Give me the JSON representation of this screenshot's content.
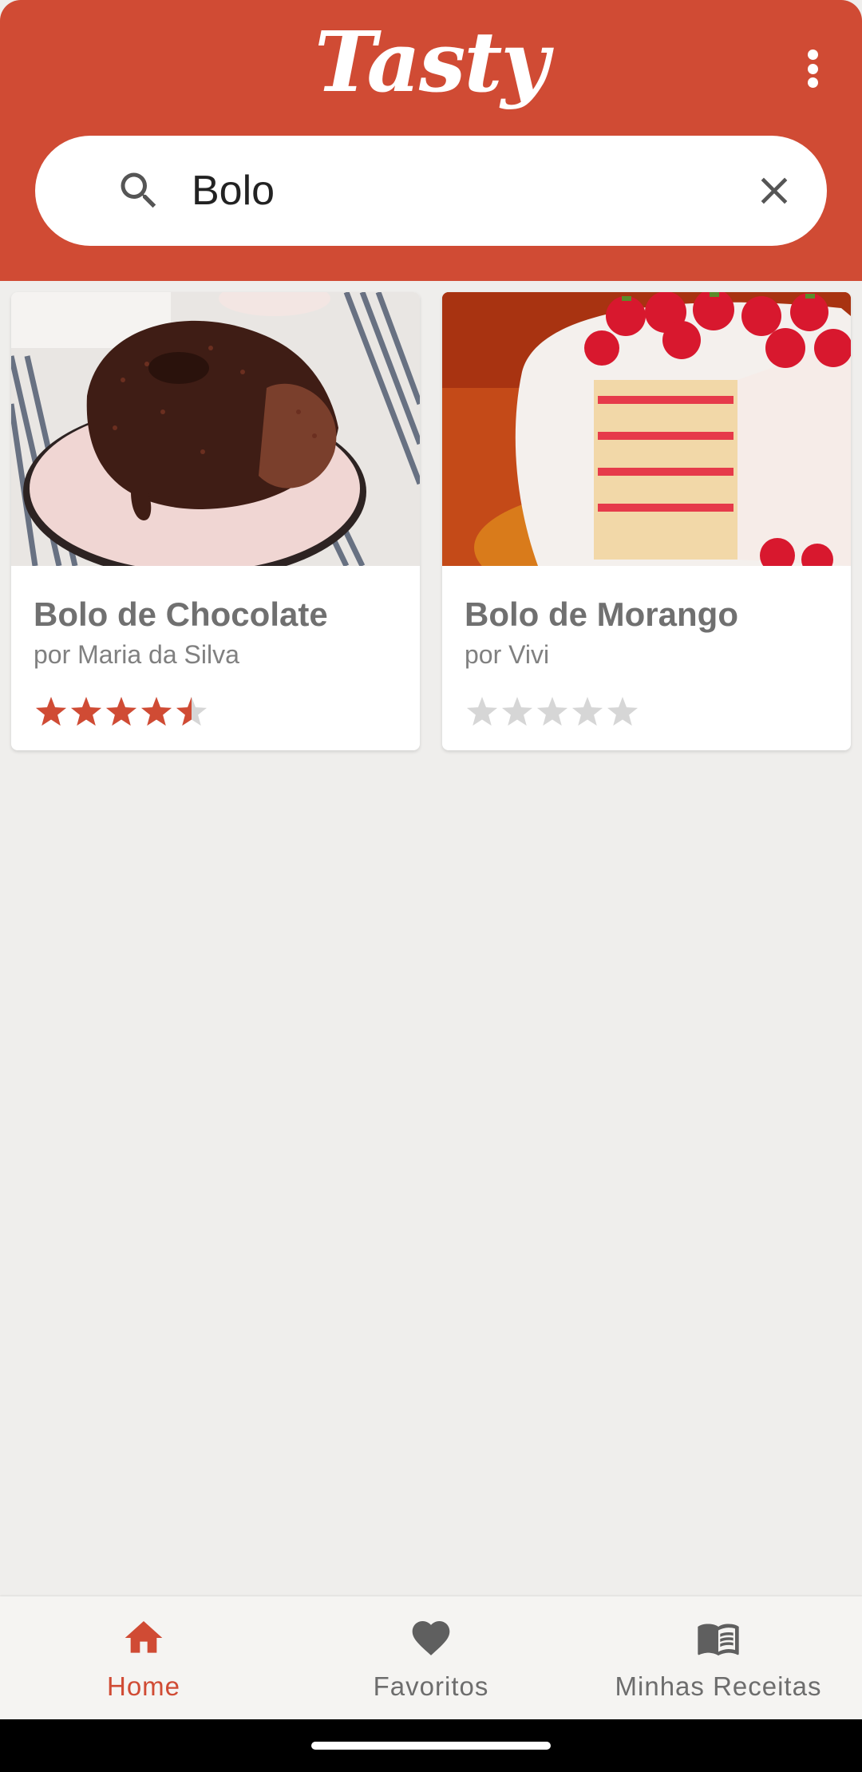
{
  "app": {
    "logo_text": "Tasty",
    "accent_color": "#d04b34",
    "menu_icon": "more-vert-icon"
  },
  "search": {
    "value": "Bolo",
    "search_icon": "search-icon",
    "clear_icon": "close-icon"
  },
  "results": [
    {
      "title": "Bolo de Chocolate",
      "author": "por Maria da Silva",
      "rating": 4.5,
      "max_rating": 5,
      "image": "chocolate-cake-photo"
    },
    {
      "title": "Bolo de Morango",
      "author": "por Vivi",
      "rating": 0,
      "max_rating": 5,
      "image": "strawberry-cake-photo"
    }
  ],
  "bottom_nav": [
    {
      "label": "Home",
      "icon": "home-icon",
      "active": true
    },
    {
      "label": "Favoritos",
      "icon": "heart-icon",
      "active": false
    },
    {
      "label": "Minhas Receitas",
      "icon": "book-icon",
      "active": false
    }
  ],
  "colors": {
    "star_filled": "#d04b34",
    "star_empty": "#d6d6d6",
    "inactive_nav": "#6d6d6d"
  }
}
